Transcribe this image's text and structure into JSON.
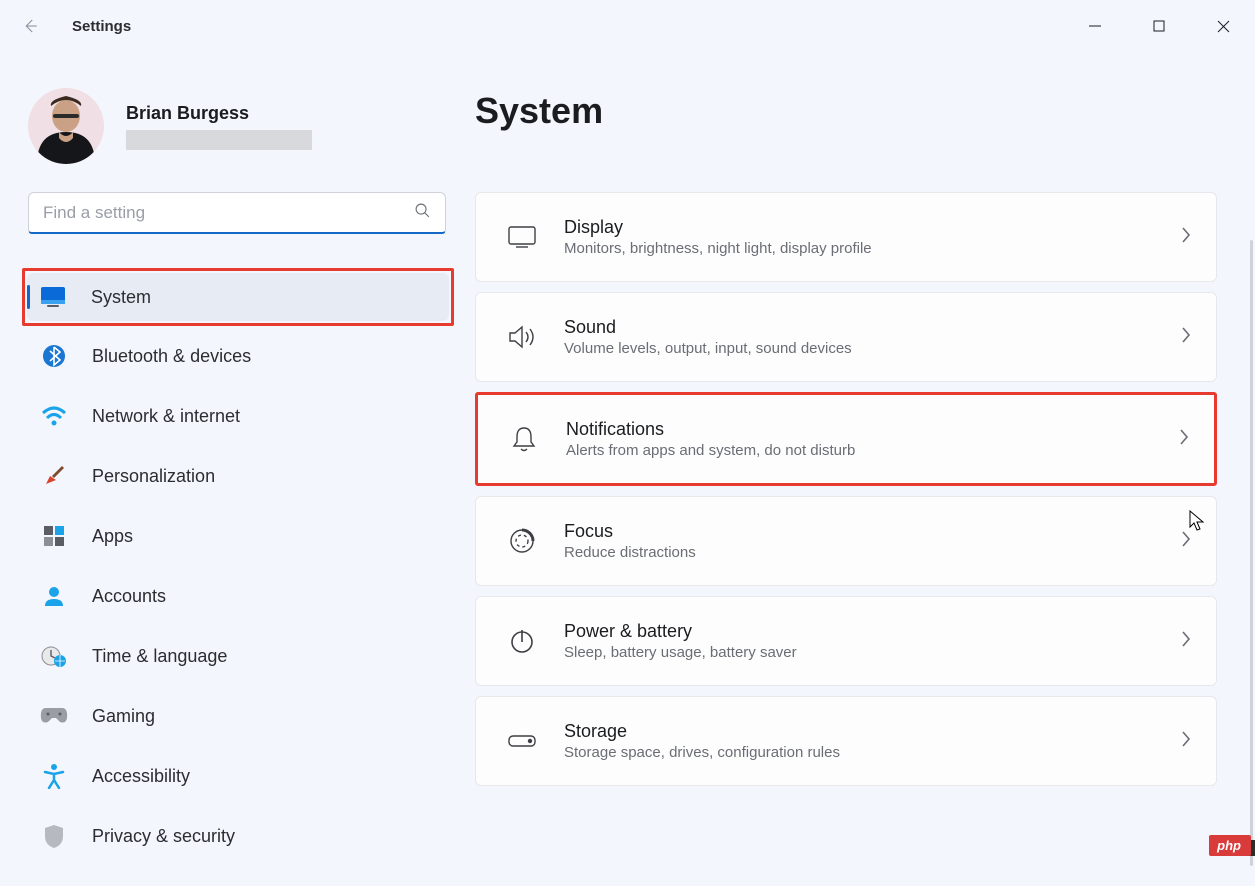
{
  "window": {
    "app_title": "Settings"
  },
  "profile": {
    "name": "Brian Burgess"
  },
  "search": {
    "placeholder": "Find a setting"
  },
  "sidebar": {
    "items": [
      {
        "label": "System"
      },
      {
        "label": "Bluetooth & devices"
      },
      {
        "label": "Network & internet"
      },
      {
        "label": "Personalization"
      },
      {
        "label": "Apps"
      },
      {
        "label": "Accounts"
      },
      {
        "label": "Time & language"
      },
      {
        "label": "Gaming"
      },
      {
        "label": "Accessibility"
      },
      {
        "label": "Privacy & security"
      }
    ]
  },
  "page": {
    "header": "System",
    "cards": [
      {
        "title": "Display",
        "subtitle": "Monitors, brightness, night light, display profile"
      },
      {
        "title": "Sound",
        "subtitle": "Volume levels, output, input, sound devices"
      },
      {
        "title": "Notifications",
        "subtitle": "Alerts from apps and system, do not disturb"
      },
      {
        "title": "Focus",
        "subtitle": "Reduce distractions"
      },
      {
        "title": "Power & battery",
        "subtitle": "Sleep, battery usage, battery saver"
      },
      {
        "title": "Storage",
        "subtitle": "Storage space, drives, configuration rules"
      }
    ]
  },
  "watermark": "php"
}
